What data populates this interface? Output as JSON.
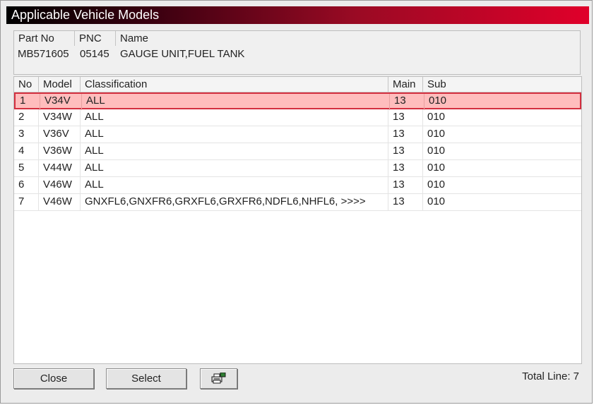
{
  "window": {
    "title": "Applicable Vehicle Models"
  },
  "part_panel": {
    "headers": {
      "part_no": "Part No",
      "pnc": "PNC",
      "name": "Name"
    },
    "values": {
      "part_no": "MB571605",
      "pnc": "05145",
      "name": "GAUGE UNIT,FUEL TANK"
    }
  },
  "table": {
    "headers": {
      "no": "No",
      "model": "Model",
      "classification": "Classification",
      "main": "Main",
      "sub": "Sub"
    },
    "rows": [
      {
        "no": "1",
        "model": "V34V",
        "classification": "ALL",
        "main": "13",
        "sub": "010"
      },
      {
        "no": "2",
        "model": "V34W",
        "classification": "ALL",
        "main": "13",
        "sub": "010"
      },
      {
        "no": "3",
        "model": "V36V",
        "classification": "ALL",
        "main": "13",
        "sub": "010"
      },
      {
        "no": "4",
        "model": "V36W",
        "classification": "ALL",
        "main": "13",
        "sub": "010"
      },
      {
        "no": "5",
        "model": "V44W",
        "classification": "ALL",
        "main": "13",
        "sub": "010"
      },
      {
        "no": "6",
        "model": "V46W",
        "classification": "ALL",
        "main": "13",
        "sub": "010"
      },
      {
        "no": "7",
        "model": "V46W",
        "classification": "GNXFL6,GNXFR6,GRXFL6,GRXFR6,NDFL6,NHFL6,  >>>>",
        "main": "13",
        "sub": "010"
      }
    ],
    "selected_row": "1",
    "selection_color": "#ffbdbd",
    "selection_border_color": "#d32f3f"
  },
  "footer": {
    "close_label": "Close",
    "select_label": "Select",
    "print_icon": "printer-icon",
    "total_text": "Total Line: 7"
  },
  "colors": {
    "title_gradient_end": "#e0002a",
    "title_gradient_start": "#000000"
  }
}
